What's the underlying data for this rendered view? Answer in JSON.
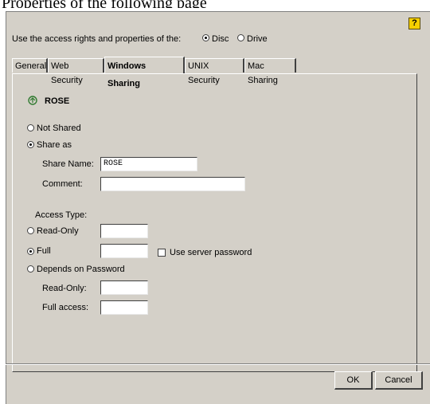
{
  "top_text": "Properties of the following page",
  "header": {
    "prompt": "Use the access rights and properties of the:",
    "options": [
      {
        "label": "Disc",
        "checked": true
      },
      {
        "label": "Drive",
        "checked": false
      }
    ],
    "help_icon": "help-icon",
    "help_glyph": "?"
  },
  "tabs": [
    {
      "label": "General",
      "active": false
    },
    {
      "label": "Web Security",
      "active": false
    },
    {
      "label": "Windows Sharing",
      "active": true
    },
    {
      "label": "UNIX Security",
      "active": false
    },
    {
      "label": "Mac Sharing",
      "active": false
    }
  ],
  "panel": {
    "share_icon": "share-icon",
    "title": "ROSE",
    "not_shared_label": "Not Shared",
    "share_as_label": "Share as",
    "share_name_label": "Share Name:",
    "share_name_value": "ROSE",
    "comment_label": "Comment:",
    "comment_value": "",
    "access_type_label": "Access Type:",
    "read_only_label": "Read-Only",
    "full_label": "Full",
    "use_server_password_label": "Use server password",
    "depends_label": "Depends on Password",
    "ro_password_label": "Read-Only:",
    "full_access_label": "Full access:",
    "selected_share_mode": "Share as",
    "selected_access": "Full"
  },
  "footer": {
    "ok_label": "OK",
    "cancel_label": "Cancel"
  }
}
